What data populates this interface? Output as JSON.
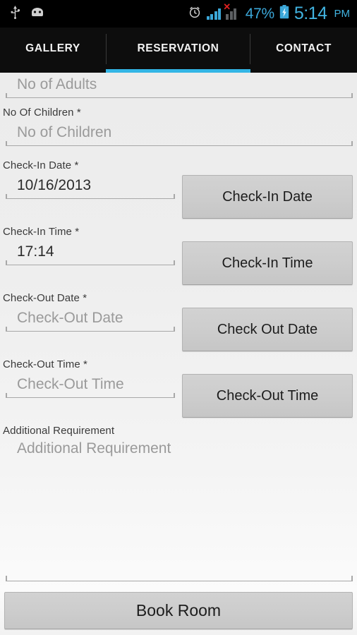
{
  "statusbar": {
    "icons": [
      "usb-icon",
      "android-debug-icon",
      "alarm-icon",
      "signal-icon",
      "signal-no-service-icon",
      "battery-charging-icon"
    ],
    "battery_percent": "47%",
    "time": "5:14",
    "ampm": "PM",
    "accent_color": "#41b3e0",
    "background": "#000000"
  },
  "tabs": {
    "items": [
      {
        "label": "GALLERY",
        "active": false
      },
      {
        "label": "RESERVATION",
        "active": true
      },
      {
        "label": "CONTACT",
        "active": false
      }
    ],
    "indicator_color": "#33b5e5"
  },
  "form": {
    "fields": [
      {
        "name": "adults",
        "label": "",
        "placeholder": "No of Adults",
        "value": ""
      },
      {
        "name": "children",
        "label": "No Of Children *",
        "placeholder": "No of Children",
        "value": ""
      },
      {
        "name": "checkin_date",
        "label": "Check-In Date *",
        "placeholder": "Check-In Date",
        "value": "10/16/2013",
        "button": "Check-In Date"
      },
      {
        "name": "checkin_time",
        "label": "Check-In Time *",
        "placeholder": "Check-In Time",
        "value": "17:14",
        "button": "Check-In Time"
      },
      {
        "name": "checkout_date",
        "label": "Check-Out Date *",
        "placeholder": "Check-Out Date",
        "value": "",
        "button": "Check Out Date"
      },
      {
        "name": "checkout_time",
        "label": "Check-Out Time *",
        "placeholder": "Check-Out Time",
        "value": "",
        "button": "Check-Out Time"
      },
      {
        "name": "additional_requirement",
        "label": "Additional Requirement",
        "placeholder": "Additional Requirement",
        "value": ""
      }
    ],
    "submit_label": "Book Room"
  }
}
